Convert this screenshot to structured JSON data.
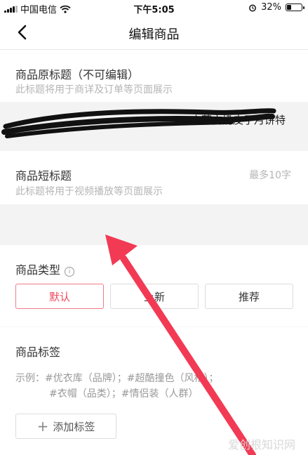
{
  "status_bar": {
    "carrier": "中国电信",
    "time": "下午5:05",
    "battery": "32%",
    "battery_level": 0.32
  },
  "nav": {
    "title": "编辑商品",
    "back_icon": "chevron-left-icon"
  },
  "original_title": {
    "label": "商品原标题（不可编辑）",
    "hint": "此标题将用于商详及订单等页面展示",
    "value": "...内蒙古奶皮子月饼特"
  },
  "short_title": {
    "label": "商品短标题",
    "limit_hint": "最多10字",
    "hint": "此标题将用于视频播放等页面展示",
    "value": ""
  },
  "product_type": {
    "label": "商品类型",
    "options": [
      "默认",
      "上新",
      "推荐"
    ],
    "selected": "默认"
  },
  "product_tags": {
    "label": "商品标签",
    "example_line1": "示例：#优衣库（品牌）；#超酷撞色（风格）；",
    "example_line2": "#衣帽（品类）；#情侣装（人群）",
    "add_button": "添加标签"
  },
  "watermark": "爱创根知识网",
  "colors": {
    "accent": "#f0485e",
    "annotation_arrow": "#f23a54",
    "scribble": "#111111"
  }
}
